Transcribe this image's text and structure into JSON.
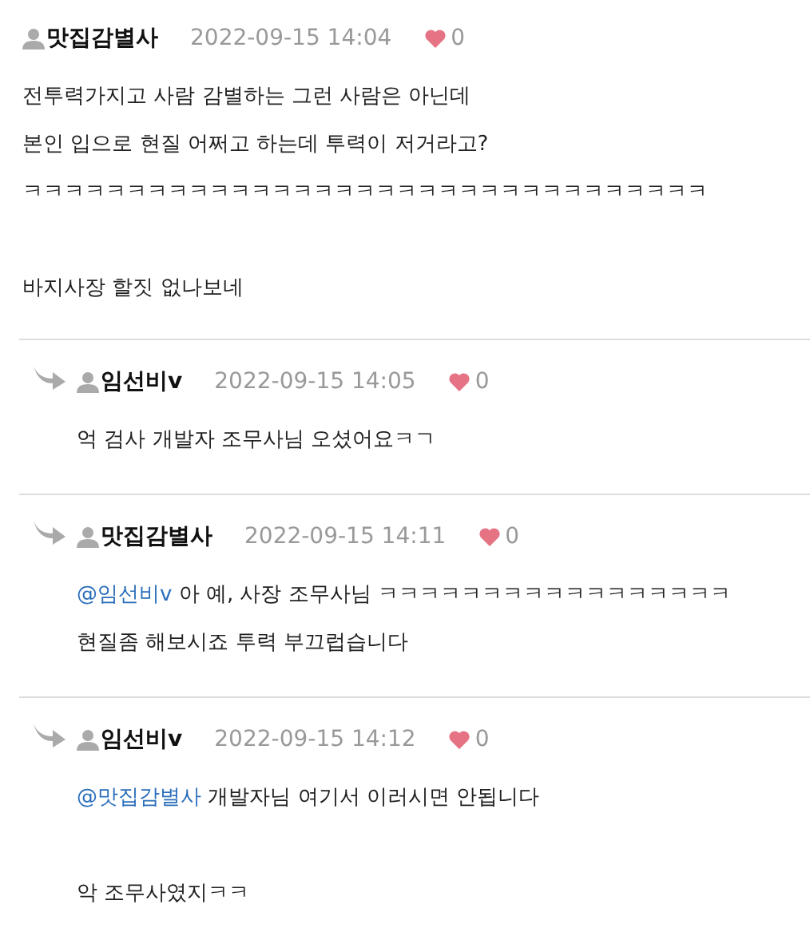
{
  "comments": [
    {
      "reply": false,
      "author": "맛집감별사",
      "date": "2022-09-15 14:04",
      "likes": "0",
      "blocks": [
        [
          {
            "text": "전투력가지고 사람 감별하는 그런 사람은 아닌데"
          },
          {
            "text": "본인 입으로 현질 어쩌고 하는데 투력이 저거라고?"
          },
          {
            "text": "ㅋㅋㅋㅋㅋㅋㅋㅋㅋㅋㅋㅋㅋㅋㅋㅋㅋㅋㅋㅋㅋㅋㅋㅋㅋㅋㅋㅋㅋㅋㅋㅋㅋ"
          }
        ],
        [
          {
            "text": "바지사장 할짓 없나보네"
          }
        ]
      ]
    },
    {
      "reply": true,
      "author": "임선비v",
      "date": "2022-09-15 14:05",
      "likes": "0",
      "blocks": [
        [
          {
            "text": "억 검사 개발자 조무사님 오셨어요ㅋㄱ"
          }
        ]
      ]
    },
    {
      "reply": true,
      "author": "맛집감별사",
      "date": "2022-09-15 14:11",
      "likes": "0",
      "blocks": [
        [
          {
            "mention": "@임선비v",
            "text": "아 예, 사장 조무사님 ㅋㅋㅋㅋㅋㅋㅋㅋㅋㅋㅋㅋㅋㅋㅋㅋㅋ"
          },
          {
            "text": "현질좀 해보시죠 투력 부끄럽습니다"
          }
        ]
      ]
    },
    {
      "reply": true,
      "author": "임선비v",
      "date": "2022-09-15 14:12",
      "likes": "0",
      "blocks": [
        [
          {
            "mention": "@맛집감별사",
            "text": "개발자님 여기서 이러시면 안됩니다"
          }
        ],
        [
          {
            "text": "악 조무사였지ㅋㅋ"
          }
        ]
      ]
    }
  ]
}
